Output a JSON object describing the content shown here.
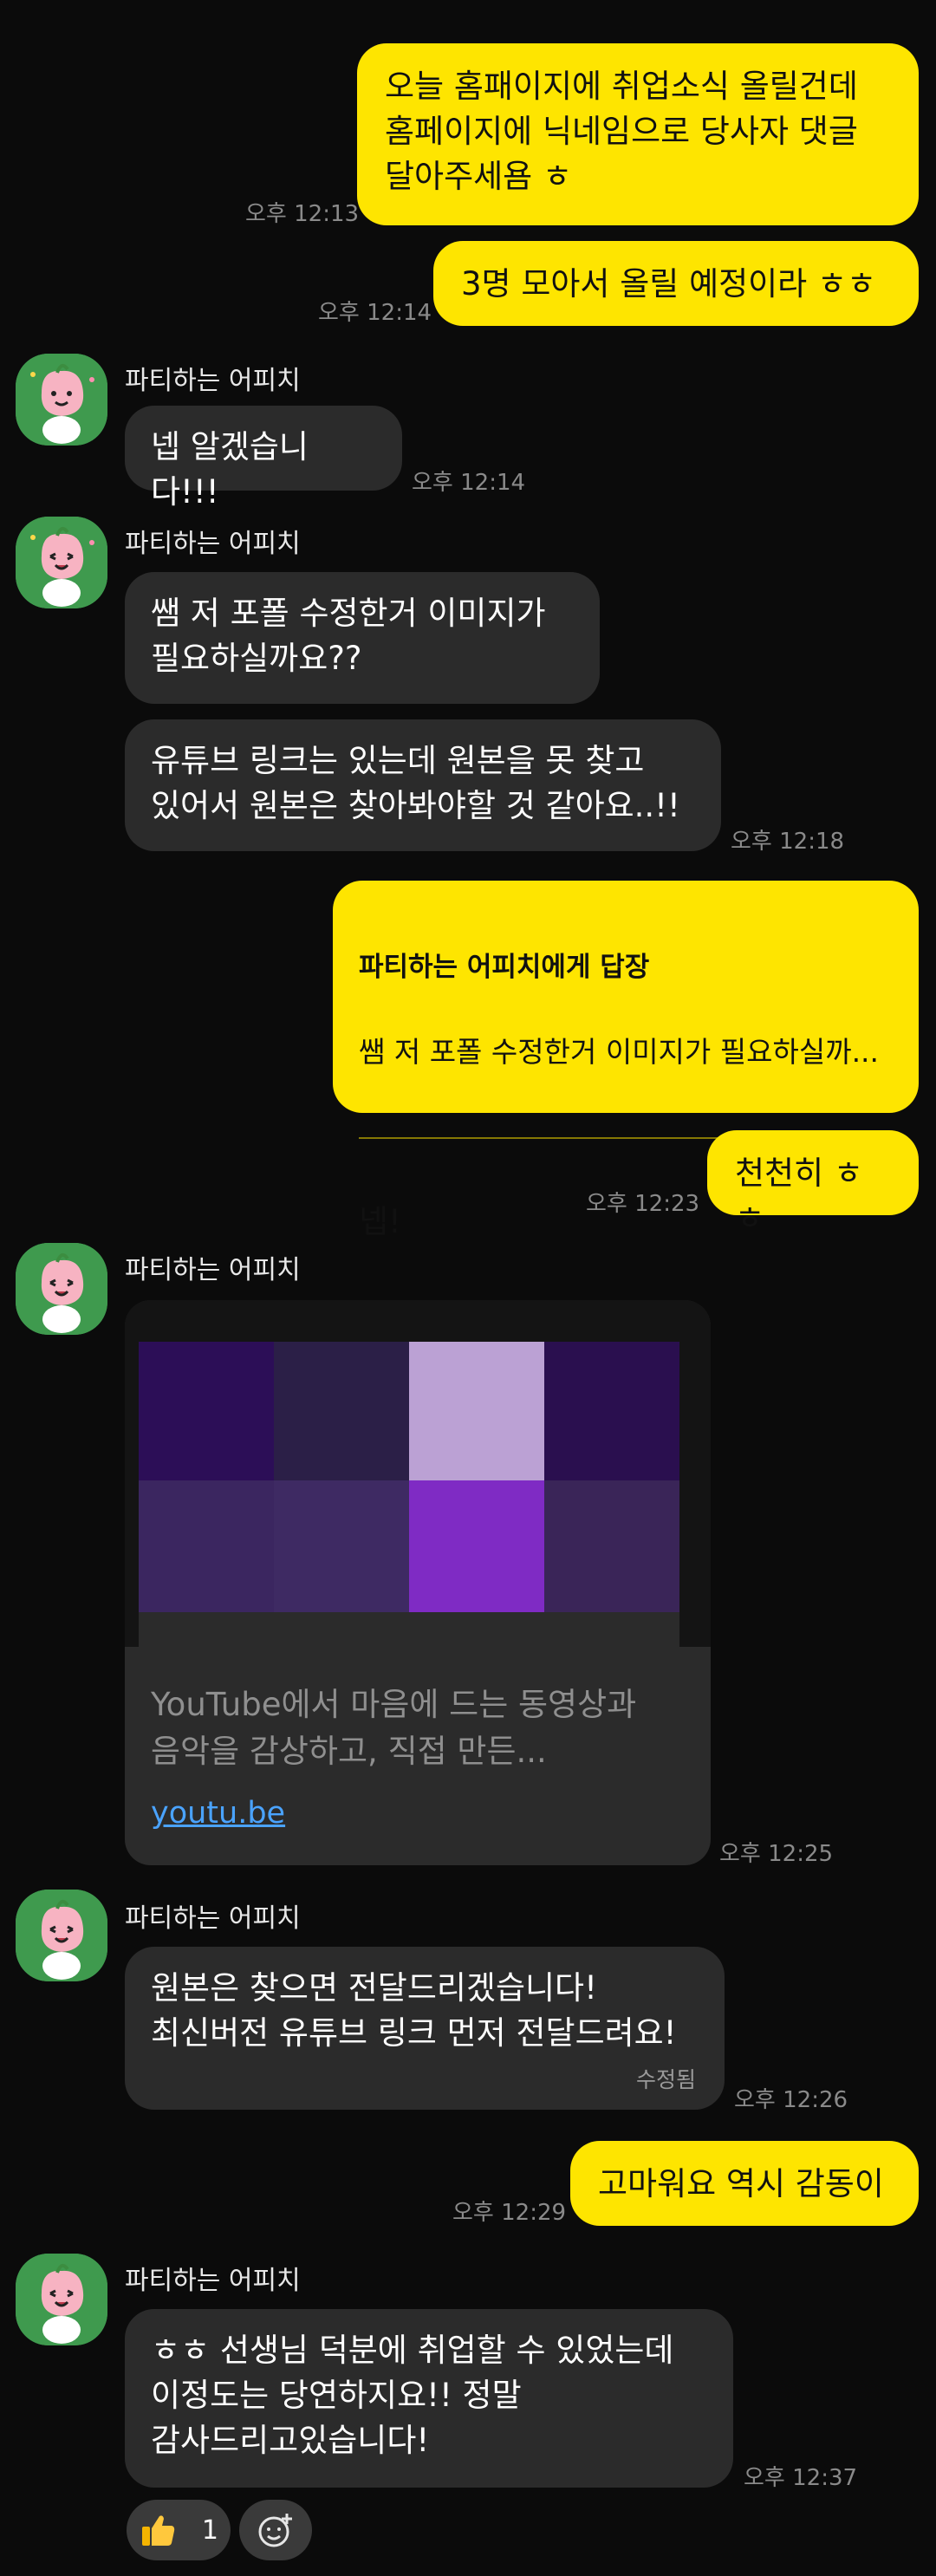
{
  "sender_name": "파티하는 어피치",
  "messages": {
    "m1": {
      "text": "오늘 홈패이지에 취업소식 올릴건데\n홈페이지에 닉네임으로 당사자 댓글\n달아주세욤 ㅎ",
      "time": "오후 12:13"
    },
    "m2": {
      "text": "3명 모아서 올릴 예정이라 ㅎㅎ",
      "time": "오후 12:14"
    },
    "t1": {
      "text": "넵 알겠습니다!!!",
      "time": "오후 12:14"
    },
    "t2a": {
      "text": "쌤 저 포폴 수정한거 이미지가\n필요하실까요??"
    },
    "t2b": {
      "text": "유튜브 링크는 있는데 원본을 못 찾고\n있어서 원본은 찾아봐야할 것 같아요..!!",
      "time": "오후 12:18"
    },
    "m3": {
      "reply_to": "파티하는 어피치에게 답장",
      "quote": "쌤 저 포폴 수정한거 이미지가 필요하실까...",
      "text": "넵!"
    },
    "m4": {
      "text": "천천히 ㅎㅎ",
      "time": "오후 12:23"
    },
    "link": {
      "desc": "YouTube에서 마음에 드는 동영상과\n음악을 감상하고, 직접 만든...",
      "url": "youtu.be",
      "time": "오후 12:25"
    },
    "t4": {
      "text": "원본은 찾으면 전달드리겠습니다!\n최신버전 유튜브 링크 먼저 전달드려요!",
      "edited": "수정됨",
      "time": "오후 12:26"
    },
    "m5": {
      "text": "고마워요 역시 감동이",
      "time": "오후 12:29"
    },
    "t5": {
      "text": "ㅎㅎ 선생님 덕분에 취업할 수 있었는데\n이정도는 당연하지요!! 정말\n감사드리고있습니다!",
      "time": "오후 12:37"
    }
  },
  "reactions": {
    "thumbs_count": "1",
    "thumbs_icon": "thumbs-up-icon",
    "add_icon": "add-reaction-icon"
  },
  "colors": {
    "my_bubble": "#fee500",
    "their_bubble": "#2b2b2b",
    "background": "#0b0b0b",
    "link": "#4aa3ff"
  }
}
